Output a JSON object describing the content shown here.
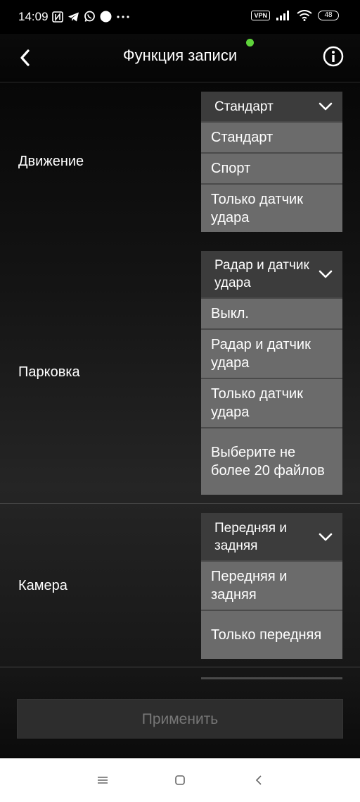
{
  "status_bar": {
    "time": "14:09",
    "icons_left": [
      "nfc-icon",
      "telegram-icon",
      "whatsapp-icon",
      "circle-icon",
      "more-dots-icon"
    ],
    "vpn": "VPN",
    "battery": "48"
  },
  "header": {
    "title": "Функция записи",
    "back_icon": "chevron-left-icon",
    "info_icon": "info-icon"
  },
  "sections": {
    "movement": {
      "label": "Движение",
      "selected": "Стандарт",
      "options": [
        "Стандарт",
        "Спорт",
        "Только датчик удара"
      ]
    },
    "parking": {
      "label": "Парковка",
      "selected": "Радар и датчик удара",
      "options": [
        "Выкл.",
        "Радар и датчик удара",
        "Только датчик удара",
        "Выберите не более 20 файлов"
      ]
    },
    "camera": {
      "label": "Камера",
      "selected": "Передняя и задняя",
      "options": [
        "Передняя и задняя",
        "Только передняя"
      ]
    }
  },
  "apply_button": "Применить",
  "colors": {
    "accent_dot": "#5ed33a",
    "dropdown_header": "#3c3c3c",
    "dropdown_option": "#6b6b6b",
    "apply_text": "#777777"
  }
}
